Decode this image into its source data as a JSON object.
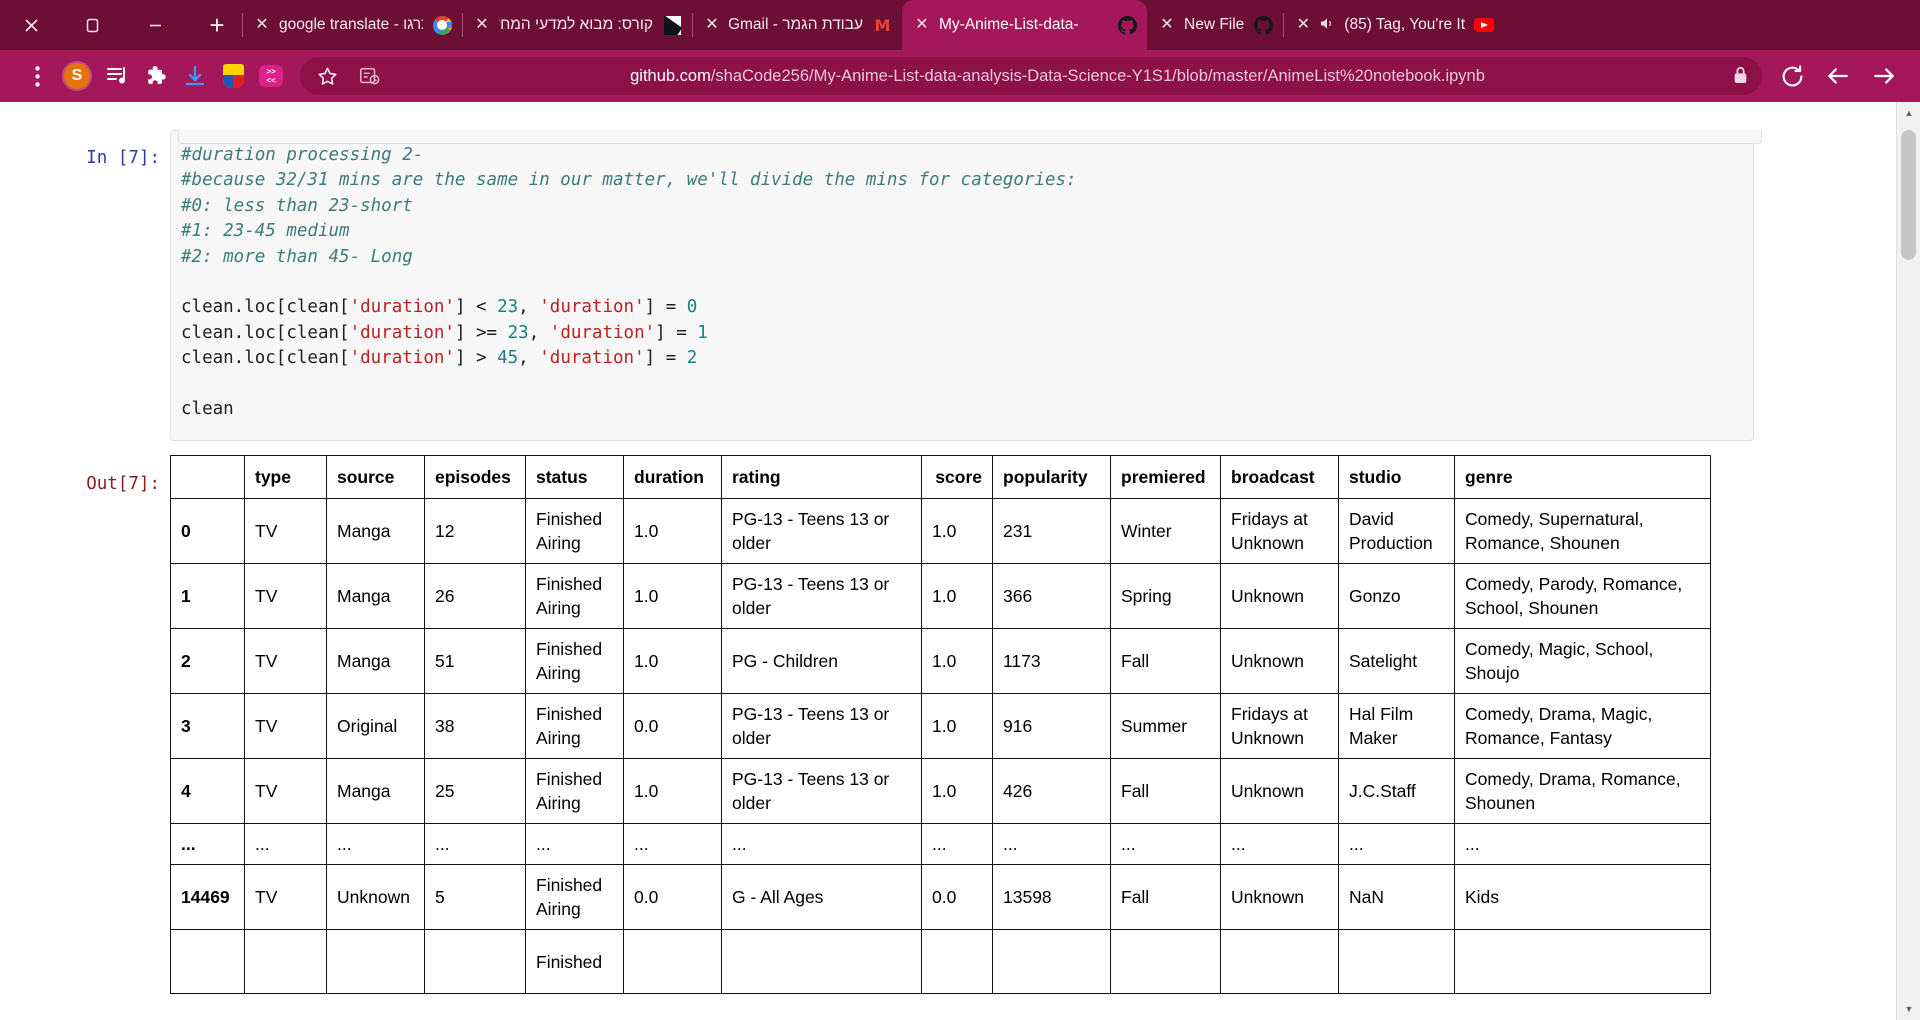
{
  "window": {
    "controls": [
      {
        "name": "close-window-button",
        "glyph": "✕"
      },
      {
        "name": "restore-window-button",
        "glyph": "❐"
      },
      {
        "name": "minimize-window-button",
        "glyph": "─"
      }
    ],
    "new_tab_glyph": "+"
  },
  "tabs": [
    {
      "title": "google translate - תרגו",
      "favicon": "google-icon",
      "active": false,
      "rtl": false,
      "close": "✕"
    },
    {
      "title": "קורס: מבוא למדעי המחשב",
      "favicon": "moodle-doc-icon",
      "active": false,
      "rtl": true,
      "close": "✕"
    },
    {
      "title": "עבודת הגמר - Gmail",
      "favicon": "gmail-icon",
      "active": false,
      "rtl": true,
      "close": "✕"
    },
    {
      "title": "My-Anime-List-data-",
      "favicon": "github-icon",
      "active": true,
      "rtl": false,
      "close": "✕"
    },
    {
      "title": "New File",
      "favicon": "github-icon",
      "active": false,
      "rtl": false,
      "close": "✕"
    },
    {
      "title": "(85) Tag, You're It",
      "favicon": "youtube-icon",
      "active": false,
      "rtl": false,
      "close": "✕",
      "audio": true
    }
  ],
  "toolbar": {
    "menu_icon": "three-dots-vertical-icon",
    "avatar_letter": "S",
    "icons": [
      {
        "name": "playlist-music-icon"
      },
      {
        "name": "extensions-puzzle-icon"
      },
      {
        "name": "downloads-icon"
      },
      {
        "name": "extension-shield-icon"
      },
      {
        "name": "extension-translate-icon"
      }
    ],
    "bookmark_icon": "star-icon",
    "qr_icon": "qr-share-icon",
    "lock_icon": "lock-icon",
    "reload_icon": "reload-icon",
    "back_icon": "back-arrow-icon",
    "forward_icon": "forward-arrow-icon",
    "url_domain": "github.com",
    "url_path": "/shaCode256/My-Anime-List-data-analysis-Data-Science-Y1S1/blob/master/AnimeList%20notebook.ipynb"
  },
  "notebook": {
    "input_prompt": "In [7]:",
    "output_prompt": "Out[7]:",
    "code_lines": [
      {
        "type": "comment",
        "text": "#duration processing 2-"
      },
      {
        "type": "comment",
        "text": "#because 32/31 mins are the same in our matter, we'll divide the mins for categories:"
      },
      {
        "type": "comment",
        "text": "#0: less than 23-short"
      },
      {
        "type": "comment",
        "text": "#1: 23-45 medium"
      },
      {
        "type": "comment",
        "text": "#2: more than 45- Long"
      },
      {
        "type": "blank",
        "text": ""
      },
      {
        "type": "code",
        "text": "clean.loc[clean['duration'] < 23, 'duration'] = 0"
      },
      {
        "type": "code",
        "text": "clean.loc[clean['duration'] >= 23, 'duration'] = 1"
      },
      {
        "type": "code",
        "text": "clean.loc[clean['duration'] > 45, 'duration'] = 2"
      },
      {
        "type": "blank",
        "text": ""
      },
      {
        "type": "code",
        "text": "clean"
      }
    ],
    "table": {
      "columns": [
        "",
        "type",
        "source",
        "episodes",
        "status",
        "duration",
        "rating",
        "score",
        "popularity",
        "premiered",
        "broadcast",
        "studio",
        "genre"
      ],
      "score_align": "right",
      "rows": [
        {
          "index": "0",
          "cells": [
            "TV",
            "Manga",
            "12",
            "Finished Airing",
            "1.0",
            "PG-13 - Teens 13 or older",
            "1.0",
            "231",
            "Winter",
            "Fridays at Unknown",
            "David Production",
            "Comedy, Supernatural, Romance, Shounen"
          ]
        },
        {
          "index": "1",
          "cells": [
            "TV",
            "Manga",
            "26",
            "Finished Airing",
            "1.0",
            "PG-13 - Teens 13 or older",
            "1.0",
            "366",
            "Spring",
            "Unknown",
            "Gonzo",
            "Comedy, Parody, Romance, School, Shounen"
          ]
        },
        {
          "index": "2",
          "cells": [
            "TV",
            "Manga",
            "51",
            "Finished Airing",
            "1.0",
            "PG - Children",
            "1.0",
            "1173",
            "Fall",
            "Unknown",
            "Satelight",
            "Comedy, Magic, School, Shoujo"
          ]
        },
        {
          "index": "3",
          "cells": [
            "TV",
            "Original",
            "38",
            "Finished Airing",
            "0.0",
            "PG-13 - Teens 13 or older",
            "1.0",
            "916",
            "Summer",
            "Fridays at Unknown",
            "Hal Film Maker",
            "Comedy, Drama, Magic, Romance, Fantasy"
          ]
        },
        {
          "index": "4",
          "cells": [
            "TV",
            "Manga",
            "25",
            "Finished Airing",
            "1.0",
            "PG-13 - Teens 13 or older",
            "1.0",
            "426",
            "Fall",
            "Unknown",
            "J.C.Staff",
            "Comedy, Drama, Romance, Shounen"
          ]
        },
        {
          "index": "...",
          "ellipsis": true,
          "cells": [
            "...",
            "...",
            "...",
            "...",
            "...",
            "...",
            "...",
            "...",
            "...",
            "...",
            "...",
            "..."
          ]
        },
        {
          "index": "14469",
          "cells": [
            "TV",
            "Unknown",
            "5",
            "Finished Airing",
            "0.0",
            "G - All Ages",
            "0.0",
            "13598",
            "Fall",
            "Unknown",
            "NaN",
            "Kids"
          ]
        },
        {
          "index": "",
          "partial": true,
          "cells": [
            "",
            "",
            "",
            "Finished",
            "",
            "",
            "",
            "",
            "",
            "",
            "",
            ""
          ]
        }
      ]
    }
  },
  "scrollbar": {
    "up_glyph": "▲",
    "down_glyph": "▼"
  }
}
